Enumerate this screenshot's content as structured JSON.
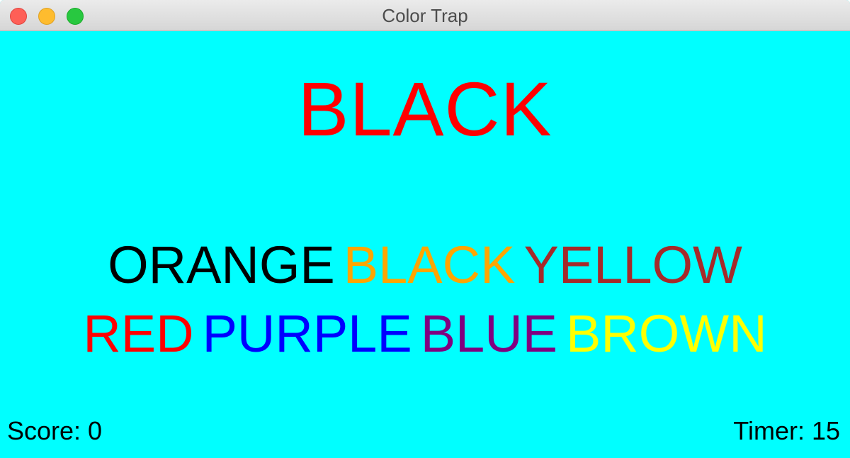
{
  "window": {
    "title": "Color Trap"
  },
  "game": {
    "prompt_word": "BLACK",
    "prompt_color": "#ff0000",
    "background_color": "#00ffff",
    "choices_row1": [
      {
        "label": "ORANGE",
        "color": "#000000"
      },
      {
        "label": "BLACK",
        "color": "#ffa500"
      },
      {
        "label": "YELLOW",
        "color": "#a52a2a"
      }
    ],
    "choices_row2": [
      {
        "label": "RED",
        "color": "#ff0000"
      },
      {
        "label": "PURPLE",
        "color": "#0000ff"
      },
      {
        "label": "BLUE",
        "color": "#800080"
      },
      {
        "label": "BROWN",
        "color": "#ffff00"
      }
    ]
  },
  "status": {
    "score_text": "Score: 0",
    "timer_text": "Timer: 15"
  }
}
